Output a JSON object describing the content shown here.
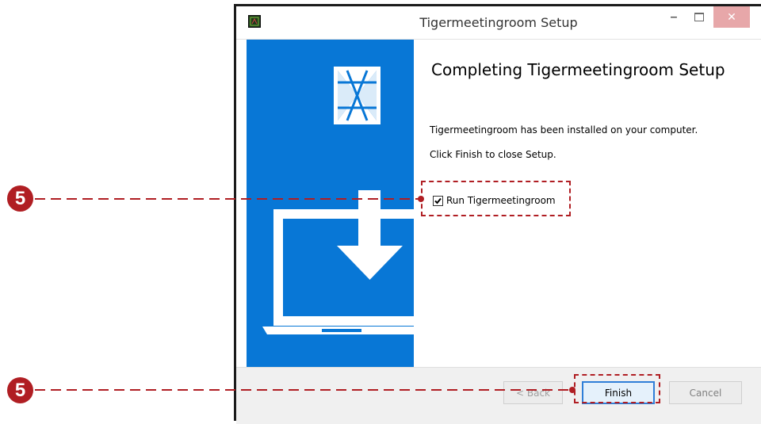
{
  "window": {
    "title": "Tigermeetingroom Setup",
    "minimize_glyph": "–",
    "close_glyph": "✕",
    "app_icon": "installer-app-icon"
  },
  "content": {
    "heading": "Completing Tigermeetingroom Setup",
    "installed_text": "Tigermeetingroom has been installed on your computer.",
    "finish_hint": "Click Finish to close Setup.",
    "run_checkbox_label": "Run Tigermeetingroom",
    "run_checkbox_checked": true
  },
  "buttons": {
    "back": "< Back",
    "finish": "Finish",
    "cancel": "Cancel"
  },
  "annotations": {
    "step_checkbox": "5",
    "step_finish": "5",
    "color": "#b01e23"
  },
  "colors": {
    "banner": "#0877d6",
    "close_button": "#e7a7a9",
    "focus_border": "#2f7fd8"
  }
}
